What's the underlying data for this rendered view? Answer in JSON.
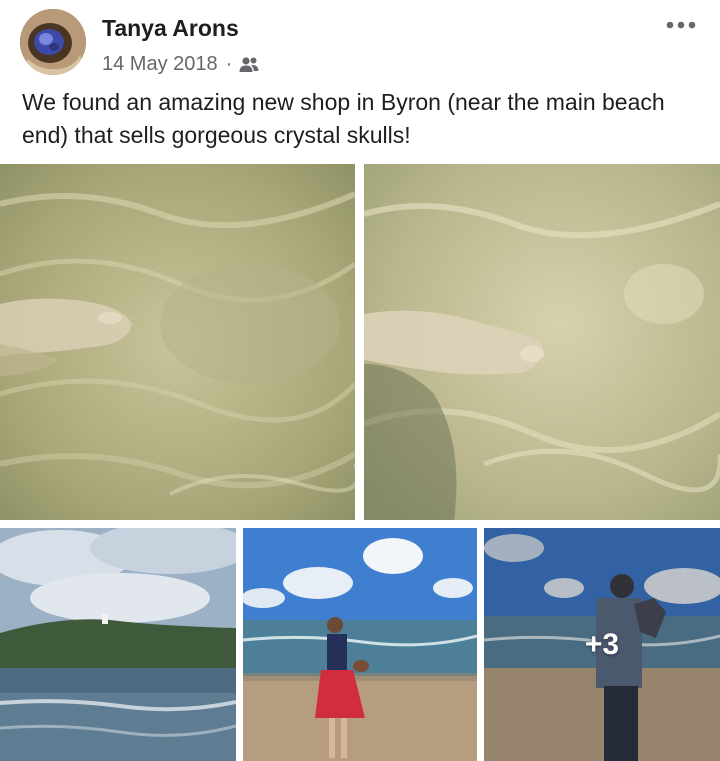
{
  "post": {
    "author": "Tanya Arons",
    "date": "14 May 2018",
    "separator": "·",
    "audience_icon": "friends-icon",
    "more_icon": "more-options-icon",
    "caption": "We found an amazing new shop in Byron (near the main beach end) that sells gorgeous crystal skulls!"
  },
  "photos": {
    "count": 5,
    "more_label": "+3"
  },
  "colors": {
    "text_primary": "#1c1e21",
    "text_secondary": "#65676b"
  }
}
